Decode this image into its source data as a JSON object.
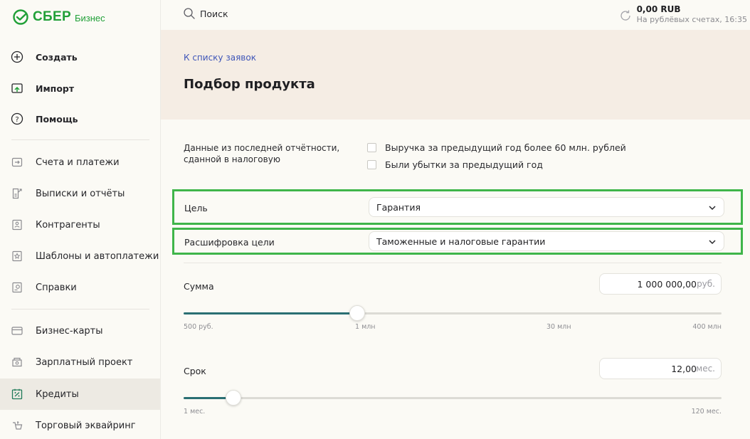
{
  "brand": {
    "name": "СБЕР",
    "product": "Бизнес",
    "color": "#21a038"
  },
  "topbar": {
    "search_label": "Поиск",
    "balance_amount": "0,00 RUB",
    "balance_sub": "На рублёвых счетах, 16:35"
  },
  "sidebar": {
    "actions": [
      {
        "label": "Создать",
        "icon": "plus-circle-icon"
      },
      {
        "label": "Импорт",
        "icon": "import-icon"
      },
      {
        "label": "Помощь",
        "icon": "help-icon"
      }
    ],
    "items": [
      {
        "label": "Счета и платежи",
        "icon": "accounts-icon"
      },
      {
        "label": "Выписки и отчёты",
        "icon": "statements-icon"
      },
      {
        "label": "Контрагенты",
        "icon": "contractors-icon"
      },
      {
        "label": "Шаблоны и автоплатежи",
        "icon": "templates-icon"
      },
      {
        "label": "Справки",
        "icon": "certificates-icon"
      },
      {
        "label": "Бизнес-карты",
        "icon": "card-icon"
      },
      {
        "label": "Зарплатный проект",
        "icon": "salary-icon"
      },
      {
        "label": "Кредиты",
        "icon": "credit-icon",
        "active": true
      },
      {
        "label": "Торговый эквайринг",
        "icon": "acquiring-icon"
      }
    ]
  },
  "main": {
    "back_link": "К списку заявок",
    "title": "Подбор продукта",
    "report_label": "Данные из последней отчётности, сданной в налоговую",
    "checkboxes": [
      {
        "label": "Выручка за предыдущий год более 60 млн. рублей",
        "checked": false
      },
      {
        "label": "Были убытки за предыдущий год",
        "checked": false
      }
    ],
    "goal": {
      "label": "Цель",
      "value": "Гарантия"
    },
    "goal_detail": {
      "label": "Расшифровка цели",
      "value": "Таможенные и налоговые гарантии"
    },
    "amount": {
      "label": "Сумма",
      "value": "1 000 000,00",
      "unit": "руб.",
      "ticks": [
        "500 руб.",
        "1 млн",
        "30 млн",
        "400 млн"
      ],
      "slider_fraction": 0.323
    },
    "term": {
      "label": "Срок",
      "value": "12,00",
      "unit": "мес.",
      "ticks": [
        "1 мес.",
        "120 мес."
      ],
      "slider_fraction": 0.092
    }
  },
  "colors": {
    "accent": "#21a038",
    "highlight": "#3fb54a",
    "slider": "#2a6f73",
    "link": "#3f56b8",
    "header_band": "#f5ede4"
  }
}
